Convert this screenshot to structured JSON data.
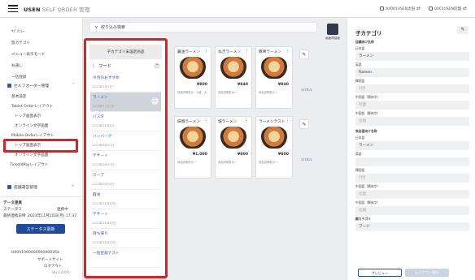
{
  "header": {
    "brand_strong": "USEN",
    "brand_rest": " SELF ORDER 管理",
    "user": "A4001USEN太田",
    "store": "0001USEN店舗"
  },
  "sidebar": {
    "items_top": [
      "ｻﾌﾞﾒﾆｭｰ",
      "旅カテゴリ",
      "メニュー表示モード",
      "お通し",
      "一括登録"
    ],
    "section": "セルフオーダー管理",
    "items": [
      "基本設定",
      "Tablet Orderレイアウト",
      "トップ画面表示",
      "オンライン文字画面",
      "Mobile Orderレイアウト",
      "トップ画面表示",
      "オンライン文字画面",
      "TicketdPayレイアウト"
    ],
    "bottom_section": "店舗運営管理",
    "status_title": "データ連携",
    "status_label": "ステータス",
    "status_value": "連携中",
    "updated_label": "最終連携日時",
    "updated_value": "2023年11月20日(月) 17:37",
    "status_button": "ステータス更新",
    "user_id": "U0001000000000000354",
    "support": "サポートサイト",
    "logout": "ログアウト",
    "version": "Ver.2.0.0.0"
  },
  "filter": {
    "label": "絞り込み検索"
  },
  "categories": {
    "title": "子カテゴリ未設定商品",
    "group": "フード",
    "rows": [
      {
        "name": "今月のおすすめ",
        "date": "2023年1月1日~"
      },
      {
        "name": "ラーメン",
        "date": "2023年11月1日~"
      },
      {
        "name": "パスタ",
        "date": "2023年11月1日~"
      },
      {
        "name": "ハンバーグ",
        "date": "2023年8月17日~"
      },
      {
        "name": "デザート",
        "date": "2023年9月15日~"
      },
      {
        "name": "スープ",
        "date": "2023年9月14日~"
      },
      {
        "name": "軽食",
        "date": "2023年11月13日~"
      },
      {
        "name": "デザート",
        "date": "2023年11月13日~"
      },
      {
        "name": "持ち帰り",
        "date": "2023年11月13日~"
      },
      {
        "name": "一括登録テスト",
        "date": ""
      }
    ]
  },
  "products": [
    {
      "name": "醤油ラーメン",
      "price": "¥800",
      "note": "商品説明表示：小盛、大"
    },
    {
      "name": "ねぎラーメン",
      "price": "¥840",
      "note": "商品説明表示～"
    },
    {
      "name": "豚骨ラーメン",
      "price": "¥840",
      "note": "商品説明表示～"
    },
    {
      "name": "味噌ラーメン",
      "price": "¥1,000",
      "note": "商品説明表示～"
    },
    {
      "name": "塩ラーメン",
      "price": "¥800",
      "note": "商品説明表示～"
    },
    {
      "name": "ラーメンテスト",
      "price": "¥800",
      "note": "商品説明表示～"
    }
  ],
  "panel_label": "3パネル",
  "preview_label": "画面再描画",
  "detail": {
    "title": "子カテゴリ",
    "sub": "店舗向け名称",
    "fields": [
      {
        "label": "日本語",
        "value": "ラーメン"
      },
      {
        "label": "英語",
        "value": "Ramen"
      },
      {
        "label": "韓国語",
        "value": "라멘"
      },
      {
        "label": "中国語（簡体字）",
        "value": "拉面"
      },
      {
        "label": "中国語（繁体字）",
        "value": "拉麵"
      }
    ],
    "sub2": "来店客向け名称",
    "fields2": [
      {
        "label": "日本語",
        "value": "ラーメン"
      },
      {
        "label": "英語",
        "value": ""
      },
      {
        "label": "韓国語",
        "value": "라멘"
      },
      {
        "label": "中国語（簡体字）",
        "value": "拉面"
      },
      {
        "label": "中国語（繁体字）",
        "value": "拉麵"
      }
    ],
    "parent_label": "親カテゴリ",
    "parent_value": "フード",
    "preview_btn": "プレビュー",
    "save_btn": "レイアウト保存"
  }
}
